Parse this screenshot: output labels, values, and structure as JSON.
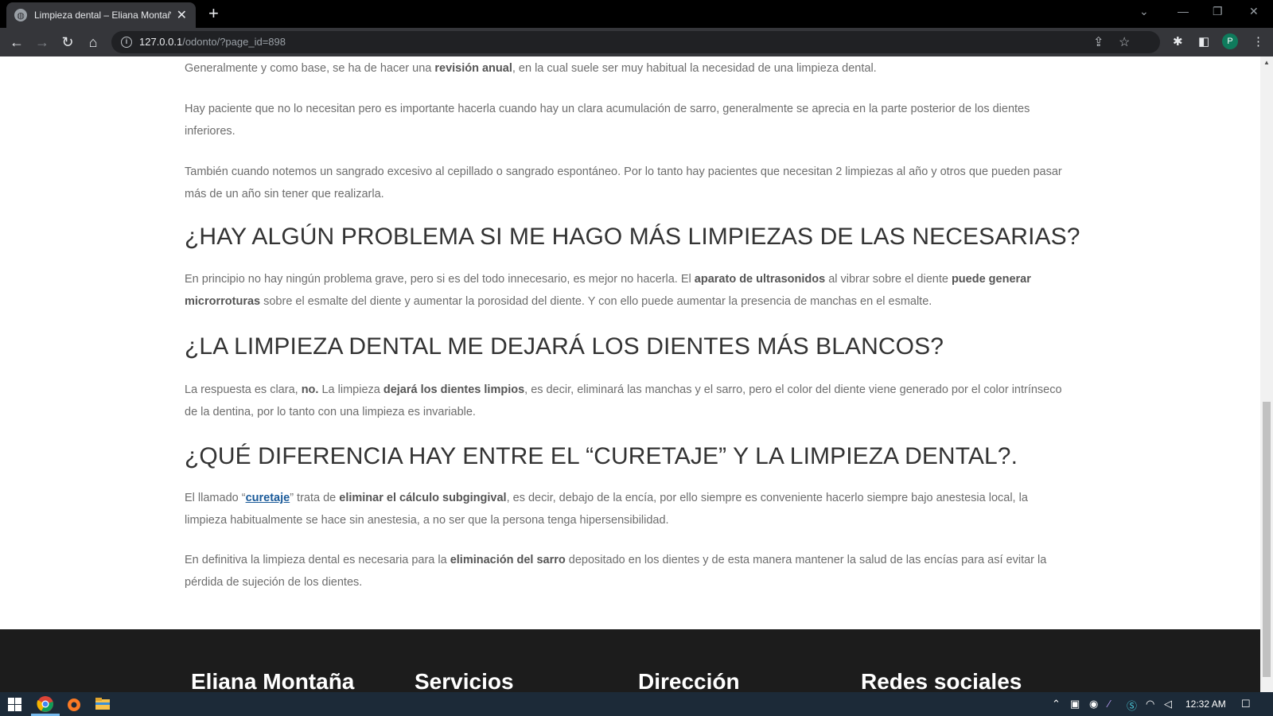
{
  "browser": {
    "tab_title": "Limpieza dental – Eliana Montaña",
    "tab_close": "✕",
    "new_tab": "+",
    "url_host": "127.0.0.1",
    "url_path": "/odonto/?page_id=898",
    "profile_initial": "P"
  },
  "article": {
    "p1": {
      "a": "Generalmente y como base, se ha de hacer una ",
      "b1": "revisión anual",
      "c": ", en la cual suele ser muy habitual la necesidad de una limpieza dental."
    },
    "p2": "Hay paciente que no lo necesitan pero es importante hacerla cuando hay un clara acumulación de sarro, generalmente se aprecia en la parte posterior de los dientes inferiores.",
    "p3": "También cuando notemos un sangrado excesivo al cepillado o sangrado espontáneo. Por lo tanto hay pacientes que necesitan 2 limpiezas al año y otros que pueden pasar más de un año sin tener que realizarla.",
    "h1": "¿HAY ALGÚN PROBLEMA SI ME HAGO MÁS LIMPIEZAS DE LAS NECESARIAS?",
    "p4": {
      "a": "En principio no hay ningún problema grave, pero si es del todo innecesario, es mejor no hacerla. El ",
      "b1": "aparato de ultrasonidos",
      "c": " al vibrar sobre el diente ",
      "b2": "puede generar microrroturas",
      "d": " sobre el esmalte del diente y aumentar la porosidad del diente. Y con ello puede aumentar la presencia de manchas en el esmalte."
    },
    "h2": "¿LA LIMPIEZA DENTAL ME DEJARÁ LOS DIENTES MÁS BLANCOS?",
    "p5": {
      "a": "La respuesta es clara, ",
      "b1": "no.",
      "c": " La limpieza ",
      "b2": "dejará los dientes limpios",
      "d": ", es decir, eliminará las manchas y el sarro, pero el color del diente viene generado por el color intrínseco de la dentina, por lo tanto con una limpieza es invariable."
    },
    "h3": "¿QUÉ DIFERENCIA HAY ENTRE EL “CURETAJE” Y LA LIMPIEZA DENTAL?.",
    "p6": {
      "a": "El llamado “",
      "link": "curetaje",
      "c": "” trata de ",
      "b1": "eliminar el cálculo subgingival",
      "d": ", es decir, debajo de la encía, por ello siempre es conveniente hacerlo siempre bajo anestesia local, la limpieza habitualmente se hace sin anestesia, a no ser que la persona tenga hipersensibilidad."
    },
    "p7": {
      "a": "En definitiva la limpieza dental es necesaria para la ",
      "b1": "eliminación del sarro",
      "c": " depositado en los dientes y de esta manera mantener la salud de las encías para así evitar la pérdida de sujeción de los dientes."
    }
  },
  "footer": {
    "col1": "Eliana Montaña",
    "col2": "Servicios",
    "col3": "Dirección",
    "col4": "Redes sociales"
  },
  "taskbar": {
    "time": "12:32 AM"
  }
}
